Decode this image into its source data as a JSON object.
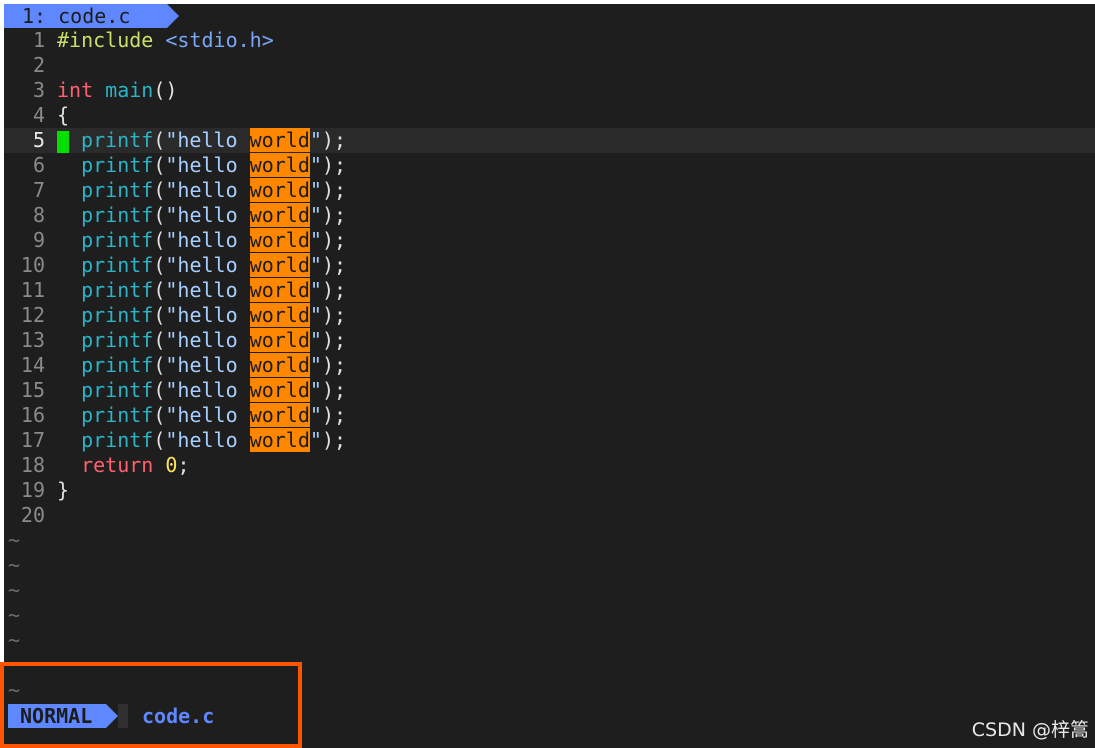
{
  "tabline": {
    "tab_label": "1: code.c"
  },
  "lines": [
    {
      "n": "1",
      "tokens": [
        [
          "pp",
          "#include "
        ],
        [
          "inc",
          "<stdio.h>"
        ]
      ]
    },
    {
      "n": "2",
      "tokens": []
    },
    {
      "n": "3",
      "tokens": [
        [
          "kw",
          "int"
        ],
        [
          "plain",
          " "
        ],
        [
          "fn",
          "main"
        ],
        [
          "plain",
          "()"
        ]
      ]
    },
    {
      "n": "4",
      "tokens": [
        [
          "plain",
          "{"
        ]
      ]
    },
    {
      "n": "5",
      "current": true,
      "cursor": true,
      "tokens": [
        [
          "plain",
          " "
        ],
        [
          "fn",
          "printf"
        ],
        [
          "plain",
          "("
        ],
        [
          "str",
          "\"hello "
        ],
        [
          "hl",
          "world"
        ],
        [
          "str",
          "\""
        ],
        [
          "plain",
          ");"
        ]
      ]
    },
    {
      "n": "6",
      "tokens": [
        [
          "plain",
          "  "
        ],
        [
          "fn",
          "printf"
        ],
        [
          "plain",
          "("
        ],
        [
          "str",
          "\"hello "
        ],
        [
          "hl",
          "world"
        ],
        [
          "str",
          "\""
        ],
        [
          "plain",
          ");"
        ]
      ]
    },
    {
      "n": "7",
      "tokens": [
        [
          "plain",
          "  "
        ],
        [
          "fn",
          "printf"
        ],
        [
          "plain",
          "("
        ],
        [
          "str",
          "\"hello "
        ],
        [
          "hl",
          "world"
        ],
        [
          "str",
          "\""
        ],
        [
          "plain",
          ");"
        ]
      ]
    },
    {
      "n": "8",
      "tokens": [
        [
          "plain",
          "  "
        ],
        [
          "fn",
          "printf"
        ],
        [
          "plain",
          "("
        ],
        [
          "str",
          "\"hello "
        ],
        [
          "hl",
          "world"
        ],
        [
          "str",
          "\""
        ],
        [
          "plain",
          ");"
        ]
      ]
    },
    {
      "n": "9",
      "tokens": [
        [
          "plain",
          "  "
        ],
        [
          "fn",
          "printf"
        ],
        [
          "plain",
          "("
        ],
        [
          "str",
          "\"hello "
        ],
        [
          "hl",
          "world"
        ],
        [
          "str",
          "\""
        ],
        [
          "plain",
          ");"
        ]
      ]
    },
    {
      "n": "10",
      "tokens": [
        [
          "plain",
          "  "
        ],
        [
          "fn",
          "printf"
        ],
        [
          "plain",
          "("
        ],
        [
          "str",
          "\"hello "
        ],
        [
          "hl",
          "world"
        ],
        [
          "str",
          "\""
        ],
        [
          "plain",
          ");"
        ]
      ]
    },
    {
      "n": "11",
      "tokens": [
        [
          "plain",
          "  "
        ],
        [
          "fn",
          "printf"
        ],
        [
          "plain",
          "("
        ],
        [
          "str",
          "\"hello "
        ],
        [
          "hl",
          "world"
        ],
        [
          "str",
          "\""
        ],
        [
          "plain",
          ");"
        ]
      ]
    },
    {
      "n": "12",
      "tokens": [
        [
          "plain",
          "  "
        ],
        [
          "fn",
          "printf"
        ],
        [
          "plain",
          "("
        ],
        [
          "str",
          "\"hello "
        ],
        [
          "hl",
          "world"
        ],
        [
          "str",
          "\""
        ],
        [
          "plain",
          ");"
        ]
      ]
    },
    {
      "n": "13",
      "tokens": [
        [
          "plain",
          "  "
        ],
        [
          "fn",
          "printf"
        ],
        [
          "plain",
          "("
        ],
        [
          "str",
          "\"hello "
        ],
        [
          "hl",
          "world"
        ],
        [
          "str",
          "\""
        ],
        [
          "plain",
          ");"
        ]
      ]
    },
    {
      "n": "14",
      "tokens": [
        [
          "plain",
          "  "
        ],
        [
          "fn",
          "printf"
        ],
        [
          "plain",
          "("
        ],
        [
          "str",
          "\"hello "
        ],
        [
          "hl",
          "world"
        ],
        [
          "str",
          "\""
        ],
        [
          "plain",
          ");"
        ]
      ]
    },
    {
      "n": "15",
      "tokens": [
        [
          "plain",
          "  "
        ],
        [
          "fn",
          "printf"
        ],
        [
          "plain",
          "("
        ],
        [
          "str",
          "\"hello "
        ],
        [
          "hl",
          "world"
        ],
        [
          "str",
          "\""
        ],
        [
          "plain",
          ");"
        ]
      ]
    },
    {
      "n": "16",
      "tokens": [
        [
          "plain",
          "  "
        ],
        [
          "fn",
          "printf"
        ],
        [
          "plain",
          "("
        ],
        [
          "str",
          "\"hello "
        ],
        [
          "hl",
          "world"
        ],
        [
          "str",
          "\""
        ],
        [
          "plain",
          ");"
        ]
      ]
    },
    {
      "n": "17",
      "tokens": [
        [
          "plain",
          "  "
        ],
        [
          "fn",
          "printf"
        ],
        [
          "plain",
          "("
        ],
        [
          "str",
          "\"hello "
        ],
        [
          "hl",
          "world"
        ],
        [
          "str",
          "\""
        ],
        [
          "plain",
          ");"
        ]
      ]
    },
    {
      "n": "18",
      "tokens": [
        [
          "plain",
          "  "
        ],
        [
          "kw",
          "return"
        ],
        [
          "plain",
          " "
        ],
        [
          "num-lit",
          "0"
        ],
        [
          "plain",
          ";"
        ]
      ]
    },
    {
      "n": "19",
      "tokens": [
        [
          "plain",
          "}"
        ]
      ]
    },
    {
      "n": "20",
      "tokens": []
    }
  ],
  "empty_lines": [
    "~",
    "~",
    "~",
    "~",
    "~",
    "",
    "~"
  ],
  "statusline": {
    "mode": "NORMAL",
    "filename": "code.c"
  },
  "colors": {
    "mode_bg": "#5f87ff",
    "highlight": "#ff8700",
    "cursor": "#00e000",
    "annotation_box": "#ff5500"
  },
  "watermark": "CSDN @梓篙"
}
